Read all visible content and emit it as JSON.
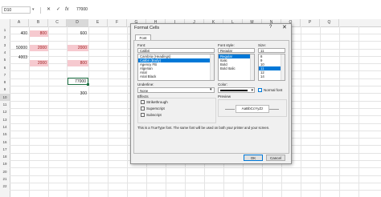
{
  "formula_bar": {
    "name_box": "D10",
    "cancel_symbol": "✕",
    "enter_symbol": "✓",
    "fx_label": "fx",
    "value": "77000"
  },
  "columns": [
    "A",
    "B",
    "C",
    "D",
    "E",
    "F",
    "G",
    "H",
    "I",
    "J",
    "K",
    "L",
    "M",
    "N",
    "O",
    "P",
    "Q"
  ],
  "rows": [
    "1",
    "2",
    "3",
    "4",
    "5",
    "6",
    "7",
    "8",
    "9",
    "10",
    "11",
    "12",
    "13",
    "14",
    "15",
    "16",
    "17",
    "18",
    "19",
    "20",
    "21",
    "22"
  ],
  "cells": {
    "a2": "400",
    "b2": "800",
    "d2": "600",
    "a4": "50000",
    "b4": "2000",
    "c4": "2000",
    "a6": "4003",
    "b7": "2000",
    "d7": "800",
    "d10": "77000",
    "d12": "300"
  },
  "dialog": {
    "title": "Format Cells",
    "help": "?",
    "close": "✕",
    "tab": "Font",
    "font_label": "Font:",
    "font_value": "Calibri",
    "font_list": [
      "Cambria (Headings)",
      "Calibri (Body)",
      "Agency FB",
      "Algerian",
      "Arial",
      "Arial Black"
    ],
    "style_label": "Font style:",
    "style_value": "Regular",
    "style_list": [
      "Regular",
      "Italic",
      "Bold",
      "Bold Italic"
    ],
    "size_label": "Size:",
    "size_value": "11",
    "size_list": [
      "8",
      "9",
      "10",
      "11",
      "12",
      "14"
    ],
    "underline_label": "Underline:",
    "underline_value": "None",
    "color_label": "Color:",
    "normal_font_label": "Normal font",
    "effects_label": "Effects",
    "strikethrough_label": "Strikethrough",
    "superscript_label": "Superscript",
    "subscript_label": "Subscript",
    "preview_label": "Preview",
    "preview_text": "AaBbCcYyZz",
    "info_text": "This is a TrueType font. The same font will be used on both your printer and your screen.",
    "ok_label": "OK",
    "cancel_label": "Cancel"
  }
}
